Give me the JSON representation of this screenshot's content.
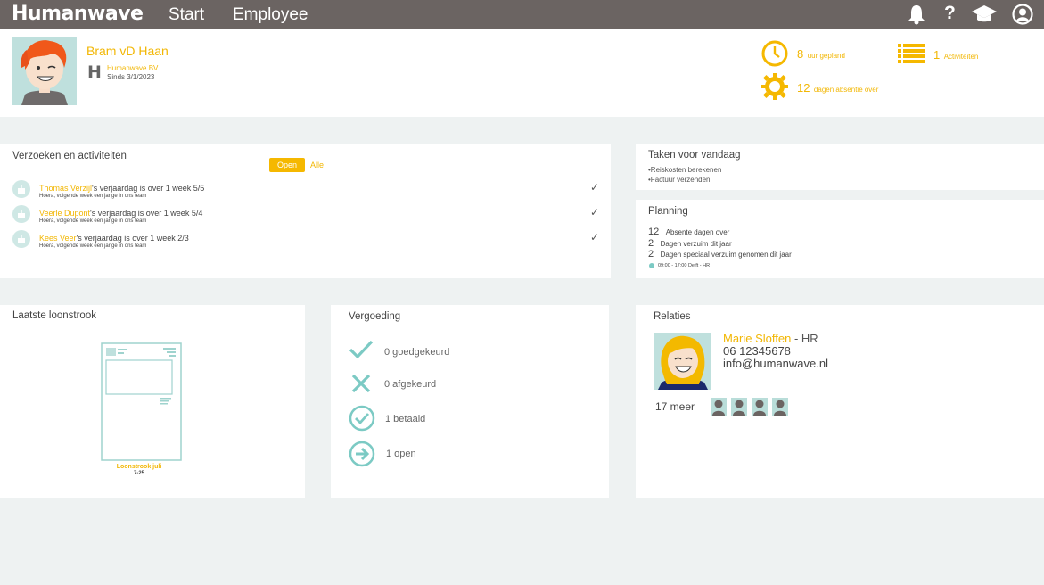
{
  "header": {
    "logo": "Humanwave",
    "nav": [
      "Start",
      "Employee"
    ],
    "icons": [
      "bell-icon",
      "help-icon",
      "graduation-cap-icon",
      "user-circle-icon"
    ]
  },
  "profile": {
    "name": "Bram vD Haan",
    "company": "Humanwave BV",
    "since": "Sinds 3/1/2023",
    "company_logo_letter": "H"
  },
  "stats": {
    "hours_value": "8",
    "hours_label": "uur gepland",
    "activities_value": "1",
    "activities_label": "Activiteiten",
    "absence_value": "12",
    "absence_label": "dagen absentie over"
  },
  "requests": {
    "title": "Verzoeken en activiteiten",
    "filter_open": "Open",
    "filter_all": "Alle",
    "items": [
      {
        "name": "Thomas Verzijl",
        "text": "'s verjaardag is over 1 week 5/5",
        "sub": "Hoera, volgende week een jarige in ons team"
      },
      {
        "name": "Veerle Dupont",
        "text": "'s verjaardag is over 1 week 5/4",
        "sub": "Hoera, volgende week een jarige in ons team"
      },
      {
        "name": "Kees Veer",
        "text": "'s verjaardag is over 1 week 2/3",
        "sub": "Hoera, volgende week een jarige in ons team"
      }
    ]
  },
  "tasks": {
    "title": "Taken voor vandaag",
    "items": [
      "•Reiskosten berekenen",
      "•Factuur verzenden"
    ]
  },
  "planning": {
    "title": "Planning",
    "rows": [
      {
        "value": "12",
        "label": "Absente dagen over"
      },
      {
        "value": "2",
        "label": "Dagen verzuim dit jaar"
      },
      {
        "value": "2",
        "label": "Dagen speciaal verzuim genomen dit jaar"
      }
    ],
    "schedule": "09:00 - 17:00 Delft - HR"
  },
  "payslip": {
    "title": "Laatste loonstrook",
    "label": "Loonstrook juli",
    "date": "7-25"
  },
  "reimbursement": {
    "title": "Vergoeding",
    "items": [
      {
        "icon": "check-icon",
        "text": "0 goedgekeurd"
      },
      {
        "icon": "cross-icon",
        "text": "0 afgekeurd"
      },
      {
        "icon": "check-circle-icon",
        "text": "1 betaald"
      },
      {
        "icon": "arrow-circle-icon",
        "text": "1 open"
      }
    ]
  },
  "relations": {
    "title": "Relaties",
    "contact_name": "Marie Sloffen",
    "contact_role": " - HR",
    "phone": "06 12345678",
    "email": "info@humanwave.nl",
    "more": "17 meer"
  },
  "colors": {
    "accent": "#f5b800",
    "teal": "#7ccac4",
    "topbar": "#6b6462"
  }
}
